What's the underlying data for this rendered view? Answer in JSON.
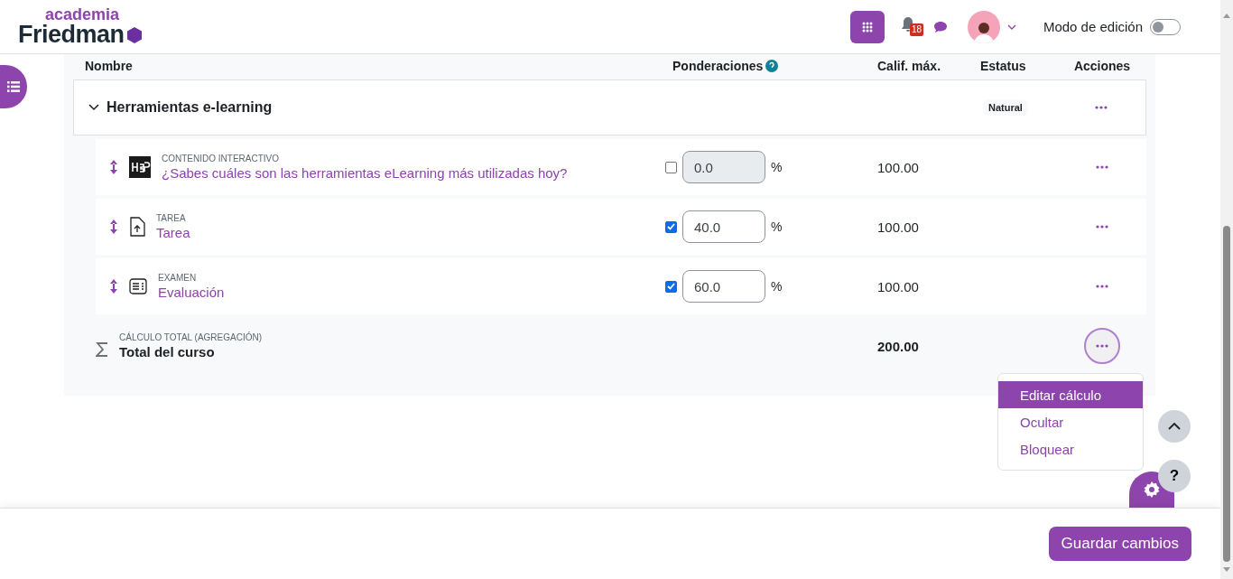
{
  "header": {
    "logo_top": "academia",
    "logo_bottom": "Friedman",
    "notifications_count": "18",
    "edit_mode": {
      "label": "Modo de edición",
      "on": false
    }
  },
  "table": {
    "columns": [
      "Nombre",
      "Ponderaciones",
      "Calif. máx.",
      "Estatus",
      "Acciones"
    ],
    "category": {
      "name": "Herramientas e-learning",
      "expanded": true,
      "status": "Natural"
    },
    "items": [
      {
        "kind": "h5p",
        "type": "CONTENIDO INTERACTIVO",
        "name": "¿Sabes cuáles son las herramientas eLearning más utilizadas hoy?",
        "weighted": false,
        "weight": "0.0",
        "unit": "%",
        "max": "100.00"
      },
      {
        "kind": "assign",
        "type": "TAREA",
        "name": "Tarea",
        "weighted": true,
        "weight": "40.0",
        "unit": "%",
        "max": "100.00"
      },
      {
        "kind": "quiz",
        "type": "EXAMEN",
        "name": "Evaluación",
        "weighted": true,
        "weight": "60.0",
        "unit": "%",
        "max": "100.00"
      }
    ],
    "total": {
      "type": "CÁLCULO TOTAL (AGREGACIÓN)",
      "name": "Total del curso",
      "max": "200.00"
    }
  },
  "actions_menu": [
    {
      "label": "Editar cálculo",
      "selected": true
    },
    {
      "label": "Ocultar",
      "selected": false
    },
    {
      "label": "Bloquear",
      "selected": false
    }
  ],
  "help_label": "?",
  "save_button": "Guardar cambios"
}
